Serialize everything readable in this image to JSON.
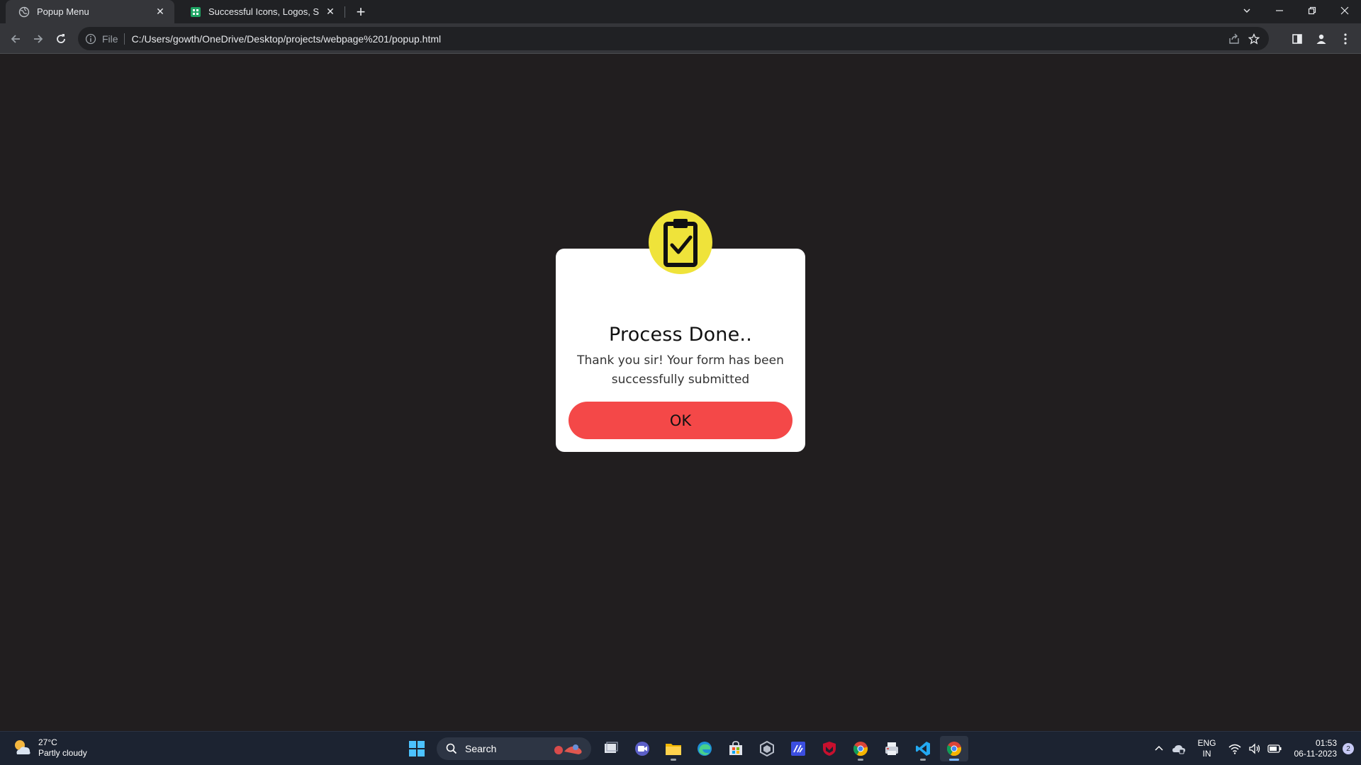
{
  "browser": {
    "tabs": [
      {
        "title": "Popup Menu",
        "active": true
      },
      {
        "title": "Successful Icons, Logos, Symbols",
        "active": false
      }
    ],
    "new_tab_label": "+",
    "address": {
      "scheme_label": "File",
      "url": "C:/Users/gowth/OneDrive/Desktop/projects/webpage%201/popup.html"
    }
  },
  "popup": {
    "title": "Process Done..",
    "message": "Thank you sir! Your form has been successfully submitted",
    "ok_label": "OK",
    "badge_color": "#efe33a",
    "button_color": "#f44848"
  },
  "taskbar": {
    "weather": {
      "temp": "27°C",
      "condition": "Partly cloudy"
    },
    "search_label": "Search",
    "apps": [
      "task-view",
      "teams-chat",
      "file-explorer",
      "edge",
      "microsoft-store",
      "unity",
      "app-blue",
      "mcafee",
      "chrome",
      "printer-app",
      "vscode",
      "chrome-active"
    ],
    "lang": {
      "line1": "ENG",
      "line2": "IN"
    },
    "clock": {
      "time": "01:53",
      "date": "06-11-2023"
    },
    "notifications": "2"
  }
}
